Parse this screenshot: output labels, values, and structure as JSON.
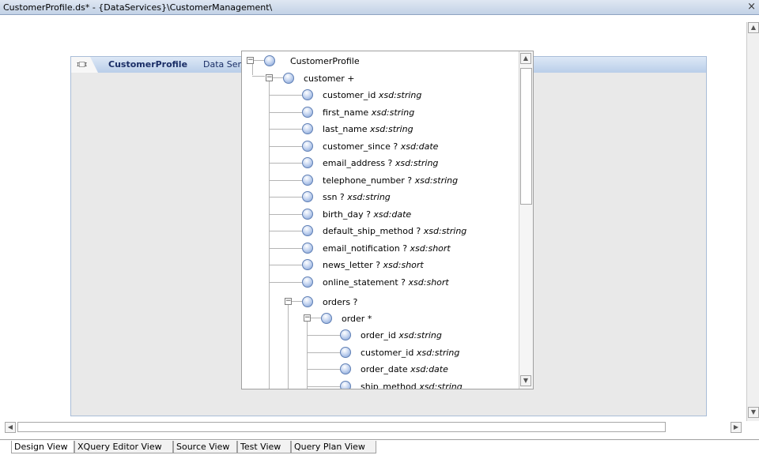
{
  "window": {
    "title": "CustomerProfile.ds* - {DataServices}\\CustomerManagement\\",
    "close_glyph": "×"
  },
  "panel": {
    "icon_glyph": "ɪ□ɪ",
    "name": "CustomerProfile",
    "type_label": "Data Service"
  },
  "tree": {
    "root": {
      "label": "CustomerProfile",
      "expanded": true
    },
    "customer": {
      "label": "customer +",
      "expanded": true
    },
    "customer_fields": [
      {
        "name": "customer_id",
        "type": "xsd:string"
      },
      {
        "name": "first_name",
        "type": "xsd:string"
      },
      {
        "name": "last_name",
        "type": "xsd:string"
      },
      {
        "name": "customer_since ?",
        "type": "xsd:date"
      },
      {
        "name": "email_address ?",
        "type": "xsd:string"
      },
      {
        "name": "telephone_number ?",
        "type": "xsd:string"
      },
      {
        "name": "ssn ?",
        "type": "xsd:string"
      },
      {
        "name": "birth_day ?",
        "type": "xsd:date"
      },
      {
        "name": "default_ship_method ?",
        "type": "xsd:string"
      },
      {
        "name": "email_notification ?",
        "type": "xsd:short"
      },
      {
        "name": "news_letter ?",
        "type": "xsd:short"
      },
      {
        "name": "online_statement ?",
        "type": "xsd:short"
      }
    ],
    "orders": {
      "label": "orders ?",
      "expanded": true
    },
    "order": {
      "label": "order *",
      "expanded": true
    },
    "order_fields": [
      {
        "name": "order_id",
        "type": "xsd:string"
      },
      {
        "name": "customer_id",
        "type": "xsd:string"
      },
      {
        "name": "order_date",
        "type": "xsd:date"
      },
      {
        "name": "ship_method",
        "type": "xsd:string"
      }
    ],
    "toggle_collapse_glyph": "−",
    "scroll_up_glyph": "▲",
    "scroll_down_glyph": "▼"
  },
  "scrollbars": {
    "up_glyph": "▲",
    "down_glyph": "▼",
    "left_glyph": "◀",
    "right_glyph": "▶"
  },
  "tabs": [
    {
      "label": "Design View",
      "active": true
    },
    {
      "label": "XQuery Editor View",
      "active": false
    },
    {
      "label": "Source View",
      "active": false
    },
    {
      "label": "Test View",
      "active": false
    },
    {
      "label": "Query Plan View",
      "active": false
    }
  ]
}
